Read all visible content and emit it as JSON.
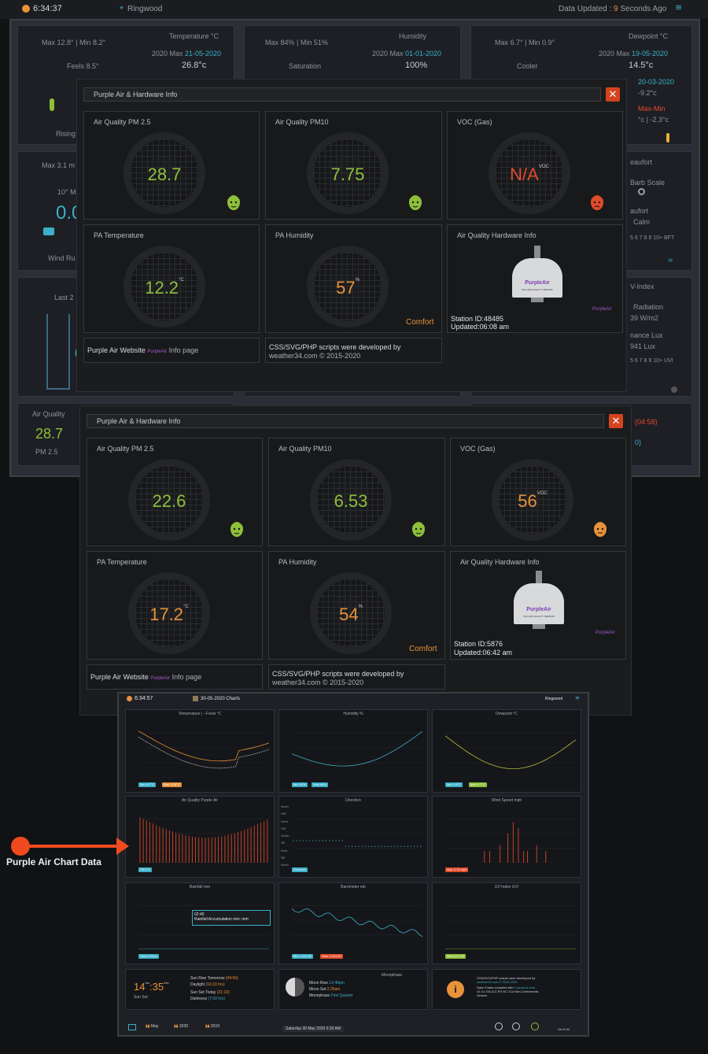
{
  "topbar": {
    "time": "6:34:37",
    "location": "Ringwood",
    "updated_prefix": "Data Updated : ",
    "updated_value": "9",
    "updated_suffix": " Seconds Ago"
  },
  "dashboard": {
    "temp": {
      "title": "Temperature °C",
      "maxmin": "Max 12.8° | Min 8.2°",
      "year_label": "2020 Max",
      "year_date": "21-05-2020",
      "year_value": "26.8°c",
      "feels_label": "Feels 8.5°",
      "trend": "Rising"
    },
    "humidity": {
      "title": "Humidity",
      "maxmin": "Max 84% | Min 51%",
      "year_label": "2020 Max",
      "year_date": "01-01-2020",
      "year_value": "100%",
      "sub": "Saturation"
    },
    "dewpoint": {
      "title": "Dewpoint °C",
      "maxmin": "Max 6.7° | Min 0.9°",
      "year_label": "2020 Max",
      "year_date": "19-05-2020",
      "year_value": "14.5°c",
      "sub": "Cooler",
      "right1": "20-03-2020",
      "right2": "-9.2°c",
      "right3": "Max-Min",
      "right4": "°c | -2.3°c"
    },
    "wind": {
      "maxlabel": "Max 3.1 m",
      "avg": "10° Mi",
      "value": "0.0",
      "rule": "Wind Ru"
    },
    "beaufort": {
      "title": "eaufort",
      "sub": "Barb Scale",
      "label": "aufort",
      "calm": "Calm",
      "scale": "5 6 7 8 9 10+ BFT"
    },
    "rain": {
      "last": "Last 2",
      "value": "0"
    },
    "uv": {
      "title": "V-Index",
      "radiation": "Radiation",
      "rad_val": "39 W/m2",
      "lux": "nance Lux",
      "lux_val": "941 Lux",
      "scale": "5 6 7 8 9 10+ UVI"
    },
    "aq": {
      "title": "Air Quality",
      "value": "28.7",
      "unit": "PM 2.5",
      "right1": "(04:58)",
      "right2": "0)"
    }
  },
  "modal1": {
    "title": "Purple Air & Hardware Info",
    "close": "✕",
    "pm25": {
      "label": "Air Quality PM 2.5",
      "value": "28.7"
    },
    "pm10": {
      "label": "Air Quality PM10",
      "value": "7.75"
    },
    "voc": {
      "label": "VOC (Gas)",
      "value": "N/A",
      "unit": "VOC"
    },
    "temp": {
      "label": "PA Temperature",
      "value": "12.2",
      "unit": "°C"
    },
    "hum": {
      "label": "PA Humidity",
      "value": "57",
      "unit": "%",
      "comfort": "Comfort"
    },
    "hw": {
      "label": "Air Quality Hardware Info",
      "station": "Station ID:48485",
      "updated": "Updated:06:08 am"
    },
    "link": {
      "a": "Purple Air Website",
      "b": "Info page"
    },
    "credit": {
      "a": "CSS/SVG/PHP scripts were developed by",
      "b": "weather34.com © 2015-2020"
    }
  },
  "modal2": {
    "title": "Purple Air & Hardware Info",
    "close": "✕",
    "pm25": {
      "label": "Air Quality PM 2.5",
      "value": "22.6"
    },
    "pm10": {
      "label": "Air Quality PM10",
      "value": "6.53"
    },
    "voc": {
      "label": "VOC (Gas)",
      "value": "56",
      "unit": "VOC"
    },
    "temp": {
      "label": "PA Temperature",
      "value": "17.2",
      "unit": "°C"
    },
    "hum": {
      "label": "PA Humidity",
      "value": "54",
      "unit": "%",
      "comfort": "Comfort"
    },
    "hw": {
      "label": "Air Quality Hardware Info",
      "station": "Station ID:5876",
      "updated": "Updated:06:42 am"
    },
    "link": {
      "a": "Purple Air Website",
      "b": "Info page"
    },
    "credit": {
      "a": "CSS/SVG/PHP scripts were developed by",
      "b": "weather34.com © 2015-2020"
    }
  },
  "sensor": {
    "brand": "PurpleAir",
    "model": "PA-II AIR QUALITY SENSOR"
  },
  "charts": {
    "time": "6:34:57",
    "date": "30-05-2020 Charts",
    "location": "Ringwood",
    "temp": {
      "title": "Temperature | --Feels",
      "unit": "°C",
      "min": "Min 8.2°C",
      "max": "Max 12.8°C"
    },
    "hum": {
      "title": "Humidity",
      "unit": "%",
      "min": "Min 51%",
      "max": "Max 84%"
    },
    "dew": {
      "title": "Dewpoint",
      "unit": "°C",
      "min": "Min 0.9°C",
      "max": "Max 6.7°C"
    },
    "aq": {
      "title": "Air Quality",
      "unit": "Purple Air",
      "tag": "PM 2.5"
    },
    "dir": {
      "title": "Direction",
      "tag": "Direction",
      "labels": [
        "North",
        "NW",
        "West",
        "SW",
        "South",
        "SE",
        "East",
        "NE",
        "North"
      ]
    },
    "wind": {
      "title": "Wind Speed",
      "unit": "mph",
      "tag": "Max 3.13 mph"
    },
    "rain": {
      "title": "Rainfall",
      "unit": "mm",
      "tag": "Total 0.0mm",
      "tip_time": "02:40",
      "tip_text": "Rainfall Accumulation mm:  mm"
    },
    "baro": {
      "title": "Barometer",
      "unit": "mb",
      "min": "Min 1,021.81",
      "max": "Max 1,023.00"
    },
    "uv": {
      "title": "UV Index",
      "unit": "UVI",
      "tag": "Max 0.0 UVI"
    },
    "sun": {
      "hrs": "14",
      "hrs_unit": "hrs",
      "min": ":35",
      "min_unit": "min",
      "label": "Sun Set",
      "l1": "Sun Rise Tomorrow",
      "l1v": "(04:56)",
      "l2": "Daylight",
      "l2v": "(16:10 hrs)",
      "l3": "Sun Set Today",
      "l3v": "(21:10)",
      "l4": "Darkness",
      "l4v": "(7:50 hrs)"
    },
    "moon": {
      "title": "Moonphase",
      "rise": "Moon Rise",
      "rise_v": "12:48pm",
      "set": "Moon Set",
      "set_v": "2:25am",
      "phase": "Moonphase",
      "phase_v": "First Quarter"
    },
    "info": {
      "l1": "CSS/SVG/PHP scripts were developed by",
      "l2": "weather34.com © 2015-2020",
      "l3": "Data Charts compiled with",
      "l3v": "CanvasJs.com",
      "l4": "v2.3.1 GA (CC BY-NC 3.0) Non-Commercial-",
      "l5": "Version"
    },
    "footer": {
      "may": "May",
      "y2020": "2020",
      "y2019": "2019",
      "date": "Saturday 30 May 2020 6:30 AM",
      "ver": "Ver 6.34"
    }
  },
  "annotation": {
    "label": "Purple Air Chart Data"
  },
  "colors": {
    "green": "#8dbf3b",
    "orange": "#e8923a",
    "red": "#e04b2a",
    "teal": "#3ab0c9",
    "purple": "#a05cc9"
  }
}
